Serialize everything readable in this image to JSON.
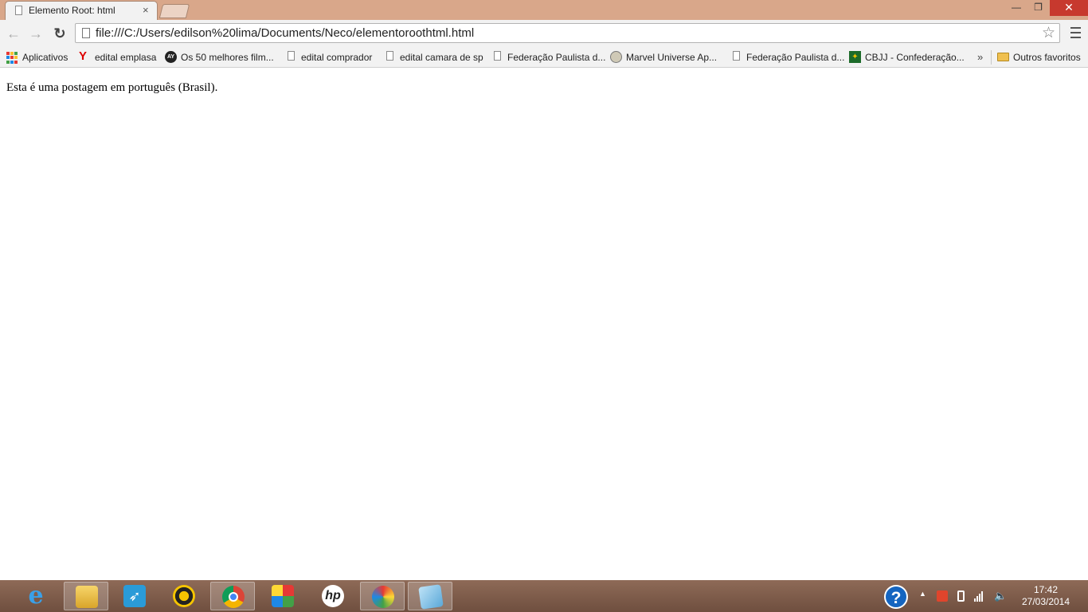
{
  "window": {
    "tab_title": "Elemento Root: html",
    "tab_close": "×",
    "minimize": "—",
    "restore": "❐",
    "close": "✕"
  },
  "toolbar": {
    "back": "←",
    "forward": "→",
    "reload": "↻",
    "url": "file:///C:/Users/edilson%20lima/Documents/Neco/elementoroothtml.html",
    "star": "☆"
  },
  "bookmarks": {
    "items": [
      {
        "label": "Aplicativos",
        "icon": "apps-grid-icon"
      },
      {
        "label": "edital emplasa",
        "icon": "yahoo-icon"
      },
      {
        "label": "Os 50 melhores film...",
        "icon": "circle-logo-icon"
      },
      {
        "label": "edital comprador",
        "icon": "page-icon"
      },
      {
        "label": "edital camara de sp",
        "icon": "page-icon"
      },
      {
        "label": "Federação Paulista d...",
        "icon": "page-icon"
      },
      {
        "label": "Marvel Universe Ap...",
        "icon": "marvel-icon"
      },
      {
        "label": "Federação Paulista d...",
        "icon": "page-icon"
      },
      {
        "label": "CBJJ - Confederação...",
        "icon": "cbjj-icon"
      }
    ],
    "overflow": "»",
    "other": "Outros favoritos"
  },
  "page": {
    "text": "Esta é uma postagem em português (Brasil)."
  },
  "taskbar": {
    "items": [
      {
        "name": "internet-explorer",
        "icon": "ie-icon"
      },
      {
        "name": "file-explorer",
        "icon": "folder-icon"
      },
      {
        "name": "rocket-app",
        "icon": "rocket-icon"
      },
      {
        "name": "media-player",
        "icon": "media-icon"
      },
      {
        "name": "chrome",
        "icon": "chrome-icon"
      },
      {
        "name": "puzzle-app",
        "icon": "puzzle-icon"
      },
      {
        "name": "hp-app",
        "icon": "hp-icon"
      },
      {
        "name": "paint-app",
        "icon": "paint-icon"
      },
      {
        "name": "notes-app",
        "icon": "notes-icon"
      }
    ],
    "help": "?",
    "hp_label": "hp",
    "clock_time": "17:42",
    "clock_date": "27/03/2014"
  }
}
